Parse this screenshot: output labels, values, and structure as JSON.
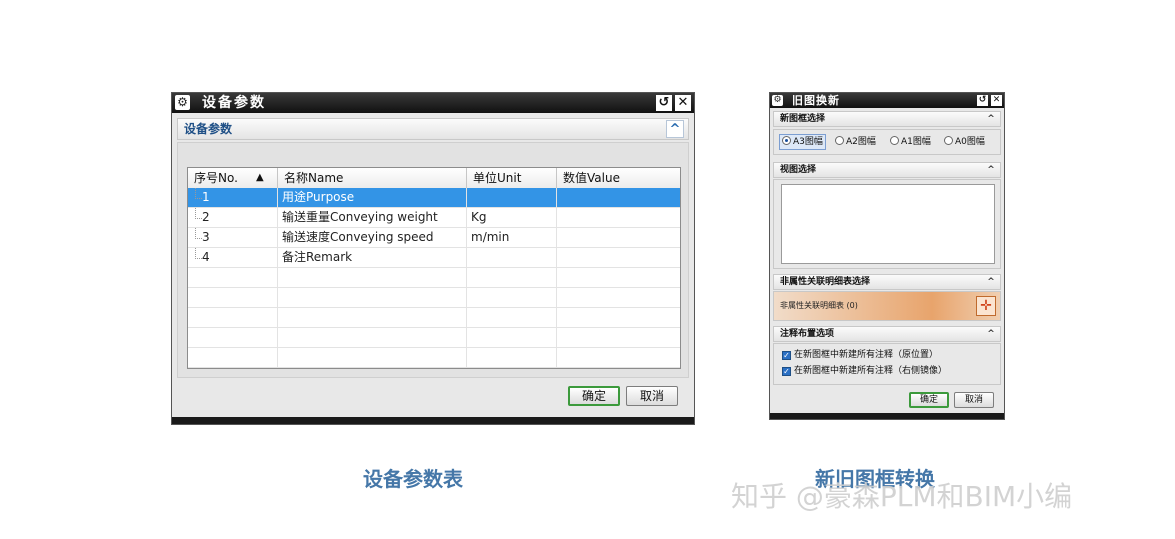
{
  "dialog1": {
    "title": "设备参数",
    "section_title": "设备参数",
    "collapse_glyph": "^",
    "gear_glyph": "⚙",
    "reset_glyph": "↺",
    "close_glyph": "✕",
    "table": {
      "columns": [
        "序号No.",
        "名称Name",
        "单位Unit",
        "数值Value"
      ],
      "sort_glyph": "▲",
      "rows": [
        {
          "no": "1",
          "name": "用途Purpose",
          "unit": "",
          "value": "",
          "selected": true
        },
        {
          "no": "2",
          "name": "输送重量Conveying weight",
          "unit": "Kg",
          "value": "",
          "selected": false
        },
        {
          "no": "3",
          "name": "输送速度Conveying speed",
          "unit": "m/min",
          "value": "",
          "selected": false
        },
        {
          "no": "4",
          "name": "备注Remark",
          "unit": "",
          "value": "",
          "selected": false
        }
      ]
    },
    "ok_label": "确定",
    "cancel_label": "取消"
  },
  "dialog2": {
    "title": "旧图换新",
    "gear_glyph": "⚙",
    "reset_glyph": "↺",
    "close_glyph": "✕",
    "frame_section": {
      "title": "新图框选择",
      "options": [
        "A3图幅",
        "A2图幅",
        "A1图幅",
        "A0图幅"
      ],
      "selected": "A3图幅"
    },
    "view_section": {
      "title": "视图选择"
    },
    "nonattr_section": {
      "title": "非属性关联明细表选择",
      "select_label": "非属性关联明细表 (0)",
      "crosshair_glyph": "✛"
    },
    "note_section": {
      "title": "注释布置选项",
      "options": [
        "在新图框中新建所有注释（原位置）",
        "在新图框中新建所有注释（右侧镜像）"
      ]
    },
    "collapse_glyph": "^",
    "ok_label": "确定",
    "cancel_label": "取消"
  },
  "captions": {
    "left": "设备参数表",
    "right": "新旧图框转换"
  },
  "watermark": "知乎 @豪森PLM和BIM小编",
  "colors": {
    "selection": "#3394e6",
    "section_title": "#1e4f86",
    "caption": "#4577a8",
    "ok_border": "#3c9a3c",
    "nonattr_gradient": "#e8a46c"
  }
}
